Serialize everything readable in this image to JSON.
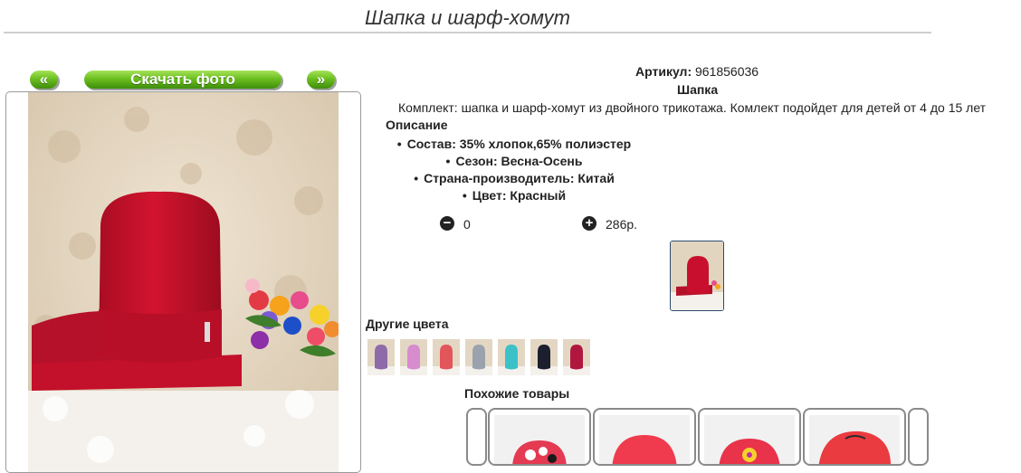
{
  "page": {
    "title": "Шапка и шарф-хомут"
  },
  "gallery": {
    "prev_label": "«",
    "download_label": "Скачать фото",
    "next_label": "»"
  },
  "product": {
    "article_label": "Артикул:",
    "article_value": "961856036",
    "type": "Шапка",
    "description_text": "Комплект: шапка и шарф-хомут из двойного трикотажа. Комлект подойдет для детей от 4 до 15 лет",
    "description_heading": "Описание",
    "specs": [
      "Состав: 35% хлопок,65% полиэстер",
      "Сезон: Весна-Осень",
      "Страна-производитель: Китай",
      "Цвет: Красный"
    ]
  },
  "cart": {
    "quantity": "0",
    "price": "286р.",
    "minus_icon": "minus-circle-icon",
    "plus_icon": "plus-circle-icon"
  },
  "other_colors": {
    "heading": "Другие цвета",
    "swatches": [
      "#8e6aa8",
      "#d68ccd",
      "#e2555b",
      "#9aa3ad",
      "#3cc1c9",
      "#1b1f2e",
      "#b0173f"
    ]
  },
  "similar": {
    "heading": "Похожие товары"
  },
  "colors": {
    "accent_green": "#6cbf20",
    "hat_red": "#c8102e"
  }
}
